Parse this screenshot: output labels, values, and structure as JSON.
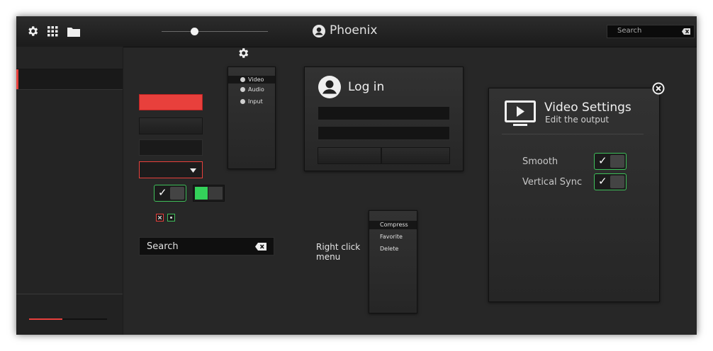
{
  "header": {
    "title": "Phoenix",
    "search_placeholder": "Search"
  },
  "controls": {
    "search_placeholder": "Search"
  },
  "settings_menu": {
    "items": [
      "Video",
      "Audio",
      "Input"
    ]
  },
  "login": {
    "title": "Log in"
  },
  "context": {
    "label": "Right click menu",
    "items": [
      "Compress",
      "Favorite",
      "Delete"
    ]
  },
  "video_settings": {
    "title": "Video Settings",
    "subtitle": "Edit the output",
    "options": [
      {
        "label": "Smooth",
        "checked": true
      },
      {
        "label": "Vertical Sync",
        "checked": true
      }
    ]
  },
  "colors": {
    "accent": "#e8403c",
    "green": "#3fbf5a"
  }
}
